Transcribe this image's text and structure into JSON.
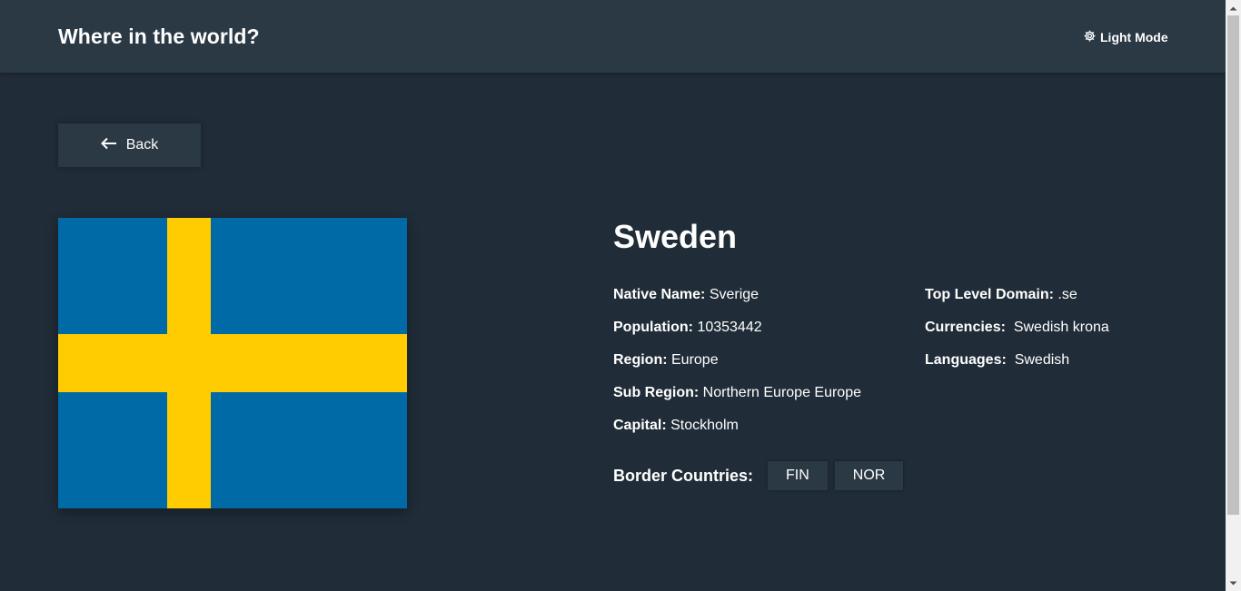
{
  "header": {
    "title": "Where in the world?",
    "theme_toggle": {
      "label": "Light Mode",
      "icon": "gear-icon"
    }
  },
  "back_button": {
    "label": "Back",
    "icon": "arrow-left-icon"
  },
  "country": {
    "name": "Sweden",
    "flag": {
      "blue": "#006aa7",
      "yellow": "#fecc00"
    },
    "details_left": [
      {
        "label": "Native Name:",
        "value": "Sverige"
      },
      {
        "label": "Population:",
        "value": "10353442"
      },
      {
        "label": "Region:",
        "value": "Europe"
      },
      {
        "label": "Sub Region:",
        "value": "Northern Europe Europe"
      },
      {
        "label": "Capital:",
        "value": "Stockholm"
      }
    ],
    "details_right": [
      {
        "label": "Top Level Domain:",
        "value": ".se"
      },
      {
        "label": "Currencies:",
        "value": " Swedish krona"
      },
      {
        "label": "Languages:",
        "value": " Swedish"
      }
    ],
    "border_label": "Border Countries:",
    "borders": [
      "FIN",
      "NOR"
    ]
  },
  "colors": {
    "background": "#202c37",
    "element": "#2b3945",
    "text": "#ffffff"
  }
}
